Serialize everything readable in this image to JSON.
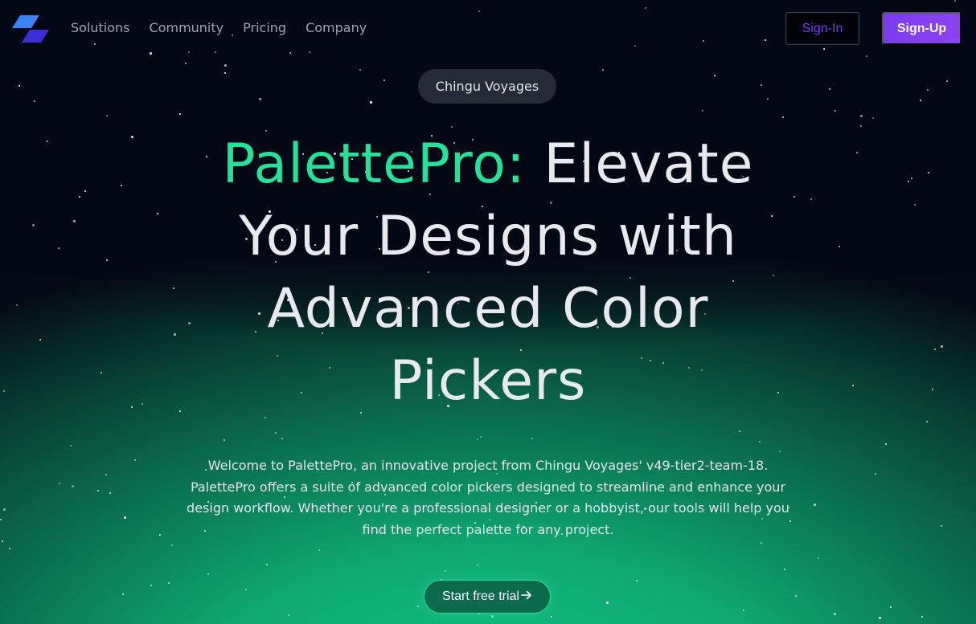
{
  "nav": {
    "links": [
      "Solutions",
      "Community",
      "Pricing",
      "Company"
    ],
    "signin_label": "Sign-In",
    "signup_label": "Sign-Up"
  },
  "badge": "Chingu Voyages",
  "hero": {
    "title_accent": "PalettePro:",
    "title_rest": "Elevate Your Designs with Advanced Color Pickers",
    "description": "Welcome to PalettePro, an innovative project from Chingu Voyages' v49-tier2-team-18. PalettePro offers a suite of advanced color pickers designed to streamline and enhance your design workflow. Whether you're a professional designer or a hobbyist, our tools will help you find the perfect palette for any project.",
    "cta_label": "Start free trial",
    "cta_icon": "arrow-right-icon"
  },
  "colors": {
    "accent_green": "#23e39a",
    "brand_purple": "#7c3aed",
    "background": "#040714"
  }
}
